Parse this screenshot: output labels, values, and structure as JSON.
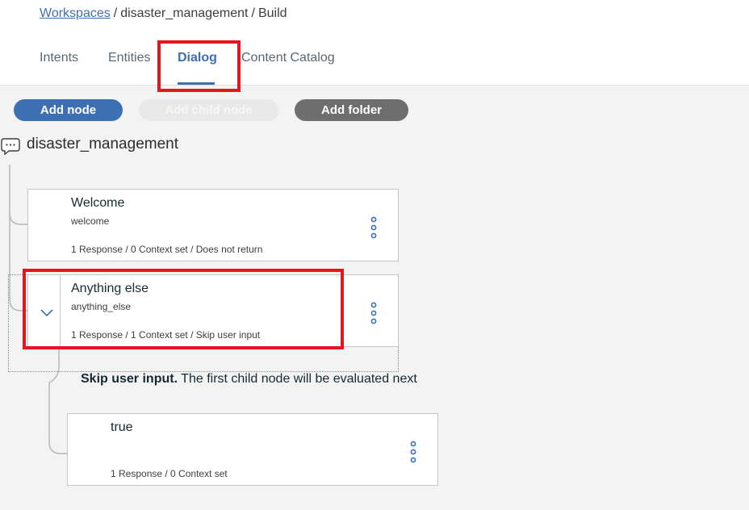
{
  "breadcrumb": {
    "workspaces_link": "Workspaces",
    "separator": "/",
    "workspace_name": "disaster_management",
    "section": "Build"
  },
  "tabs": [
    {
      "label": "Intents",
      "active": false
    },
    {
      "label": "Entities",
      "active": false
    },
    {
      "label": "Dialog",
      "active": true
    },
    {
      "label": "Content Catalog",
      "active": false
    }
  ],
  "toolbar": {
    "add_node_label": "Add node",
    "add_child_node_label": "Add child node",
    "add_folder_label": "Add folder"
  },
  "dialog": {
    "root_name": "disaster_management",
    "root_icon": "chat-bubble-icon",
    "nodes": [
      {
        "title": "Welcome",
        "condition": "welcome",
        "meta": "1 Response / 0 Context set / Does not return"
      },
      {
        "title": "Anything else",
        "condition": "anything_else",
        "meta": "1 Response / 1 Context set / Skip user input",
        "expanded": true
      }
    ],
    "skip_note": {
      "bold": "Skip user input.",
      "rest": "The first child node will be evaluated next"
    },
    "child_node": {
      "title": "true",
      "meta": "1 Response / 0 Context set"
    }
  },
  "colors": {
    "accent": "#3d70b2",
    "highlight": "#e8151f",
    "folder_button": "#6e6e6e"
  }
}
